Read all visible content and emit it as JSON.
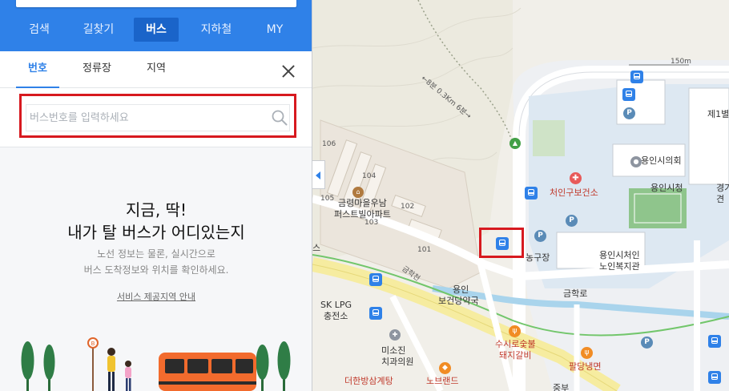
{
  "nav": {
    "items": [
      {
        "label": "검색",
        "active": false
      },
      {
        "label": "길찾기",
        "active": false
      },
      {
        "label": "버스",
        "active": true
      },
      {
        "label": "지하철",
        "active": false
      },
      {
        "label": "MY",
        "active": false
      }
    ]
  },
  "subtabs": {
    "items": [
      {
        "label": "번호",
        "active": true
      },
      {
        "label": "정류장",
        "active": false
      },
      {
        "label": "지역",
        "active": false
      }
    ]
  },
  "search": {
    "placeholder": "버스번호를 입력하세요",
    "value": ""
  },
  "empty_state": {
    "headline_line1": "지금, 딱!",
    "headline_line2": "내가 탈 버스가 어디있는지",
    "desc_line1": "노선 정보는 물론, 실시간으로",
    "desc_line2": "버스 도착정보와 위치를 확인하세요.",
    "service_link": "서비스 제공지역 안내"
  },
  "map": {
    "trail_label": "←8분 0.3Km 6분→",
    "scale_label": "150m",
    "labels": {
      "bldg_106": "106",
      "bldg_104": "104",
      "bldg_105": "105",
      "bldg_102": "102",
      "bldg_103": "103",
      "bldg_101": "101",
      "apt_name_1": "금령마을우남",
      "apt_name_2": "퍼스트빌아파트",
      "yongin_pharmacy_1": "용인",
      "yongin_pharmacy_2": "보건당약국",
      "lpg_1": "SK LPG",
      "lpg_2": "충전소",
      "dental_1": "미소진",
      "dental_2": "치과의원",
      "daehan": "더한방삼계탕",
      "nobrand": "노브랜드",
      "dongrim_1": "수시로숯불",
      "dongrim_2": "돼지갈비",
      "palddang": "팔당냉면",
      "cheoin_health": "처인구보건소",
      "yongin_council": "용인시의회",
      "yongin_cityhall": "용인시청",
      "senior_1": "용인시처인",
      "senior_2": "노인복지관",
      "basketball": "농구장",
      "geumhak_road": "금학로",
      "geumhak_stream": "금학천",
      "first_edge": "제1별",
      "gyeong_edge1": "경기",
      "gyeong_edge2": "견",
      "left_edge": "스",
      "bottom_edge": "중부"
    }
  }
}
